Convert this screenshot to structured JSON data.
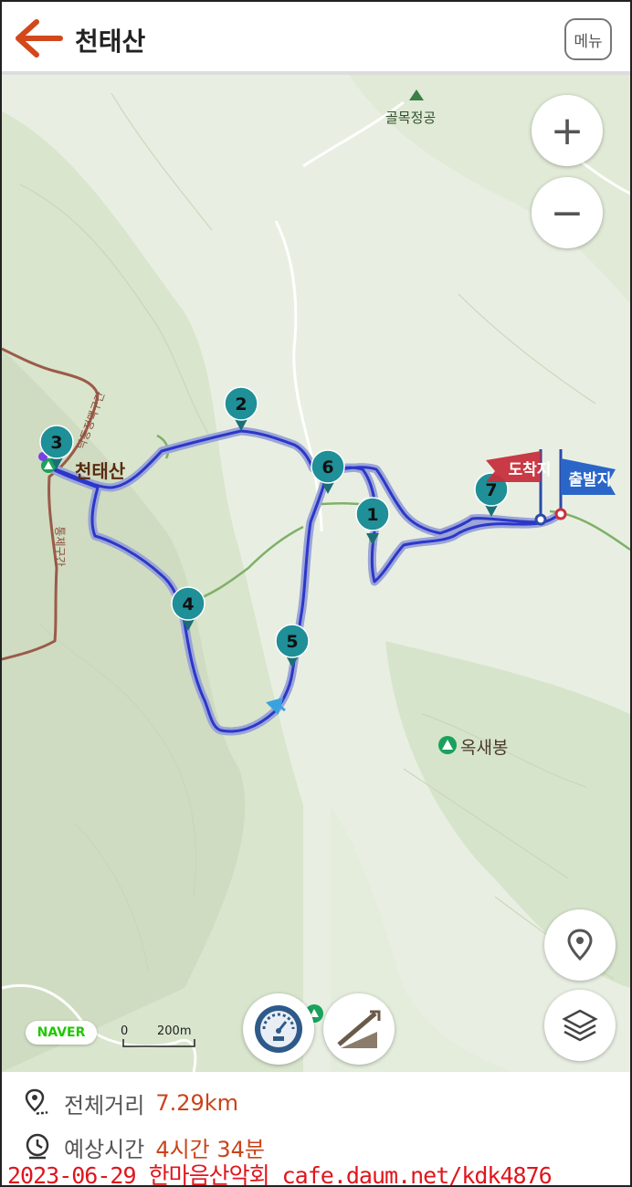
{
  "header": {
    "title": "천태산",
    "menu_label": "메뉴",
    "back_icon": "back-arrow-icon",
    "accent_color": "#d2481b"
  },
  "map": {
    "labels": {
      "peak_main": "천태산",
      "peak_okse": "옥새봉",
      "poi_golmok": "골목정공",
      "ridge_1": "낙동정맥구간",
      "ridge_2": "통제구간"
    },
    "flags": {
      "arrival": "도착지",
      "departure": "출발지"
    },
    "waypoints": [
      "1",
      "2",
      "3",
      "4",
      "5",
      "6",
      "7"
    ],
    "zoom_in": "+",
    "zoom_out": "−",
    "naver_logo": "NAVER",
    "scale": {
      "zero": "0",
      "distance": "200m"
    },
    "route_color": "#2b37c9",
    "marker_color": "#1f8f98"
  },
  "info": {
    "distance_label": "전체거리",
    "distance_value": "7.29km",
    "time_label": "예상시간",
    "time_value": "4시간 34분"
  },
  "watermark": "2023-06-29 한마음산악회 cafe.daum.net/kdk4876"
}
